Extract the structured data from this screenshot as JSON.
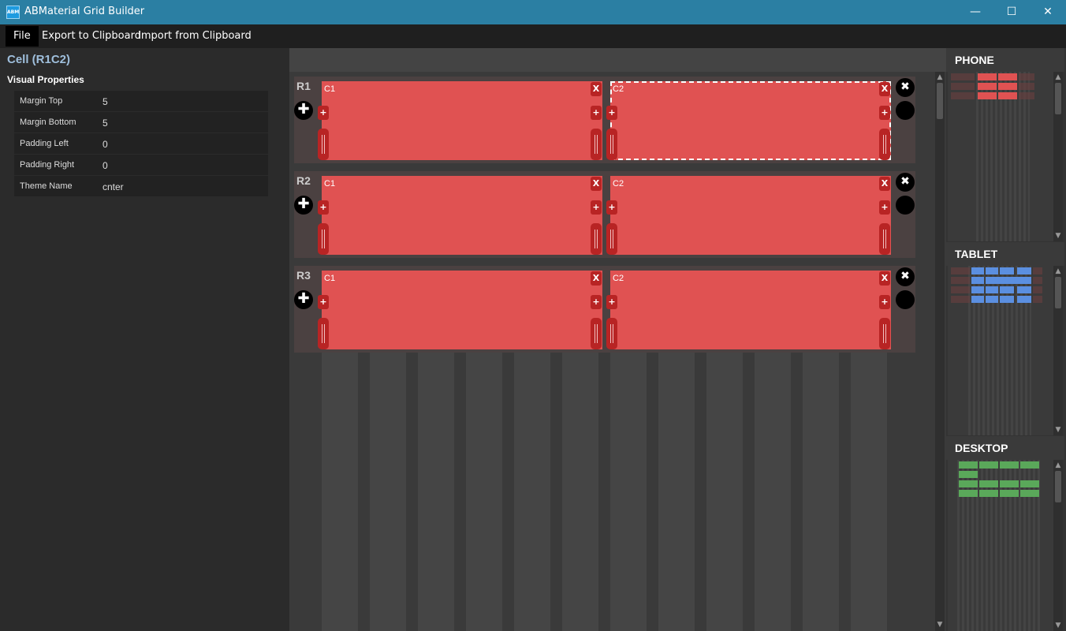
{
  "window": {
    "title": "ABMaterial Grid Builder",
    "icon_text": "ABM",
    "controls": {
      "minimize": "—",
      "maximize": "☐",
      "close": "✕"
    }
  },
  "menu": {
    "items": [
      "File",
      "Export to Clipboard",
      "Import from Clipboard"
    ]
  },
  "inspector": {
    "cell_title": "Cell (R1C2)",
    "section_title": "Visual Properties",
    "properties": [
      {
        "key": "Margin Top",
        "value": "5"
      },
      {
        "key": "Margin Bottom",
        "value": "5"
      },
      {
        "key": "Padding Left",
        "value": "0"
      },
      {
        "key": "Padding Right",
        "value": "0"
      },
      {
        "key": "Theme Name",
        "value": "cnter"
      }
    ]
  },
  "grid": {
    "rows": [
      {
        "label": "R1",
        "cells": [
          {
            "label": "C1"
          },
          {
            "label": "C2"
          }
        ]
      },
      {
        "label": "R2",
        "cells": [
          {
            "label": "C1"
          },
          {
            "label": "C2"
          }
        ]
      },
      {
        "label": "R3",
        "cells": [
          {
            "label": "C1"
          },
          {
            "label": "C2"
          }
        ]
      }
    ],
    "selected_cell": "R1C2",
    "cell_color": "#e05252",
    "button_color": "#b82424",
    "add_glyph": "+",
    "remove_glyph": "X",
    "row_add_glyph": "✚",
    "row_remove_glyph": "✖"
  },
  "previews": {
    "phone": {
      "label": "PHONE",
      "color": "#e05252"
    },
    "tablet": {
      "label": "TABLET",
      "color": "#5b8fe0"
    },
    "desktop": {
      "label": "DESKTOP",
      "color": "#5aa85a"
    }
  }
}
